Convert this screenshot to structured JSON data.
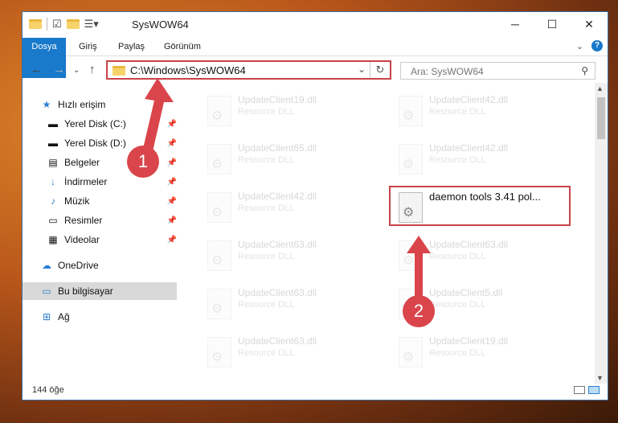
{
  "window": {
    "title": "SysWOW64"
  },
  "ribbon": {
    "tabs": [
      "Dosya",
      "Giriş",
      "Paylaş",
      "Görünüm"
    ]
  },
  "address": {
    "path": "C:\\Windows\\SysWOW64"
  },
  "search": {
    "placeholder": "Ara: SysWOW64"
  },
  "nav": {
    "items": [
      {
        "label": "Hızlı erişim",
        "icon": "star-icon"
      },
      {
        "label": "Yerel Disk (C:)",
        "icon": "drive-icon",
        "pinned": true
      },
      {
        "label": "Yerel Disk (D:)",
        "icon": "drive-icon",
        "pinned": true
      },
      {
        "label": "Belgeler",
        "icon": "document-icon",
        "pinned": true
      },
      {
        "label": "İndirmeler",
        "icon": "download-icon",
        "pinned": true
      },
      {
        "label": "Müzik",
        "icon": "music-icon",
        "pinned": true
      },
      {
        "label": "Resimler",
        "icon": "pictures-icon",
        "pinned": true
      },
      {
        "label": "Videolar",
        "icon": "video-icon",
        "pinned": true
      },
      {
        "label": "OneDrive",
        "icon": "cloud-icon"
      },
      {
        "label": "Bu bilgisayar",
        "icon": "computer-icon",
        "selected": true
      },
      {
        "label": "Ağ",
        "icon": "network-icon"
      }
    ]
  },
  "files": [
    {
      "name": "UpdateClient19.dll",
      "type": "Resource DLL"
    },
    {
      "name": "UpdateClient42.dll",
      "type": "Resource DLL"
    },
    {
      "name": "UpdateClient65.dll",
      "type": "Resource DLL"
    },
    {
      "name": "UpdateClient42.dll",
      "type": "Resource DLL"
    },
    {
      "name": "UpdateClient42.dll",
      "type": "Resource DLL"
    },
    {
      "name": "daemon tools 3.41 pol...",
      "type": ""
    },
    {
      "name": "UpdateClient63.dll",
      "type": "Resource DLL"
    },
    {
      "name": "UpdateClient63.dll",
      "type": "Resource DLL"
    },
    {
      "name": "UpdateClient63.dll",
      "type": "Resource DLL"
    },
    {
      "name": "UpdateClient5.dll",
      "type": "Resource DLL"
    },
    {
      "name": "UpdateClient63.dll",
      "type": "Resource DLL"
    },
    {
      "name": "UpdateClient19.dll",
      "type": "Resource DLL"
    }
  ],
  "status": {
    "count": "144 öğe"
  },
  "annotations": [
    "1",
    "2"
  ],
  "colors": {
    "accent": "#1979ca",
    "highlight": "#c9444a"
  }
}
